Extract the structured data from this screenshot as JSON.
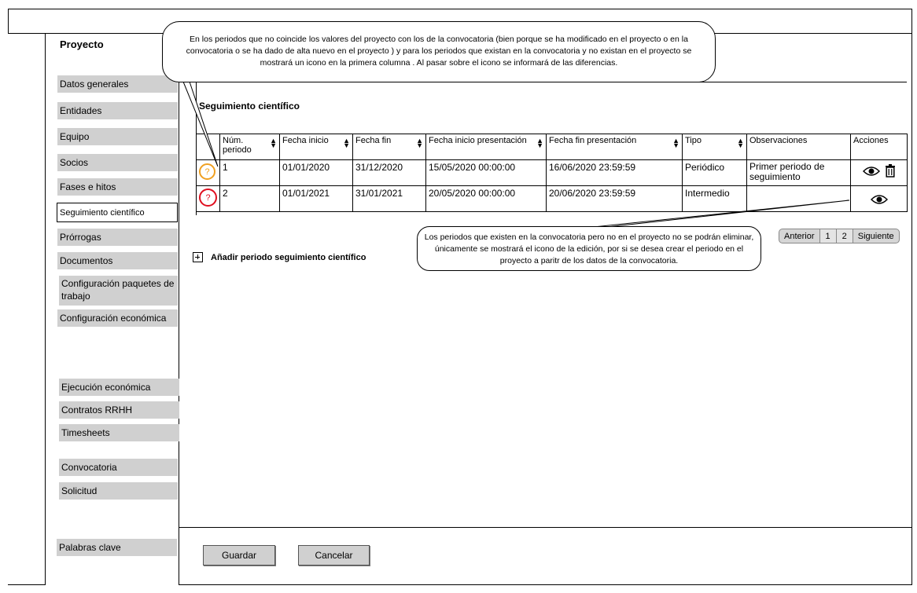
{
  "project_title": "Proyecto",
  "sidebar": {
    "items": [
      {
        "label": "Datos generales"
      },
      {
        "label": "Entidades"
      },
      {
        "label": "Equipo"
      },
      {
        "label": "Socios"
      },
      {
        "label": "Fases e hitos"
      },
      {
        "label": "Seguimiento científico"
      },
      {
        "label": "Prórrogas"
      },
      {
        "label": "Documentos"
      },
      {
        "label": "Configuración paquetes de trabajo"
      },
      {
        "label": "Configuración económica"
      },
      {
        "label": "Ejecución económica"
      },
      {
        "label": "Contratos RRHH"
      },
      {
        "label": "Timesheets"
      },
      {
        "label": "Convocatoria"
      },
      {
        "label": "Solicitud"
      },
      {
        "label": "Palabras clave"
      }
    ]
  },
  "section": {
    "title": "Seguimiento científico"
  },
  "table": {
    "headers": [
      "Núm. periodo",
      "Fecha inicio",
      "Fecha fin",
      "Fecha inicio presentación",
      "Fecha fin presentación",
      "Tipo",
      "Observaciones",
      "Acciones"
    ],
    "rows": [
      {
        "status_icon": "question-warning-icon",
        "num": "1",
        "inicio": "01/01/2020",
        "fin": "31/12/2020",
        "inicio_pres": "15/05/2020 00:00:00",
        "fin_pres": "16/06/2020 23:59:59",
        "tipo": "Periódico",
        "observaciones": "Primer periodo de seguimiento",
        "actions": [
          "eye-icon",
          "trash-icon"
        ]
      },
      {
        "status_icon": "question-error-icon",
        "num": "2",
        "inicio": "01/01/2021",
        "fin": "31/01/2021",
        "inicio_pres": "20/05/2020 00:00:00",
        "fin_pres": "20/06/2020 23:59:59",
        "tipo": "Intermedio",
        "observaciones": "",
        "actions": [
          "eye-icon"
        ]
      }
    ]
  },
  "add_link": {
    "label": "Añadir periodo seguimiento científico"
  },
  "pager": {
    "prev": "Anterior",
    "pages": [
      "1",
      "2"
    ],
    "next": "Siguiente"
  },
  "callouts": {
    "top": "En los periodos que no coincide los valores del proyecto con los de la convocatoria (bien porque se ha modificado en el proyecto o en la convocatoria o se ha dado de alta nuevo en el proyecto ) y para los periodos que existan en la convocatoria y no existan en el proyecto se mostrará un icono en la primera columna . Al pasar sobre el icono se informará de las diferencias.",
    "middle": "Los periodos que existen en la convocatoria pero no en el proyecto no se podrán eliminar, únicamente se mostrará el icono de la edición, por si se desea crear el periodo en el proyecto a paritr de los datos de la convocatoria."
  },
  "footer": {
    "save_label": "Guardar",
    "cancel_label": "Cancelar"
  },
  "colors": {
    "warning": "#f0a020",
    "error": "#e01020",
    "sidebar_bg": "#d0d0d0"
  }
}
